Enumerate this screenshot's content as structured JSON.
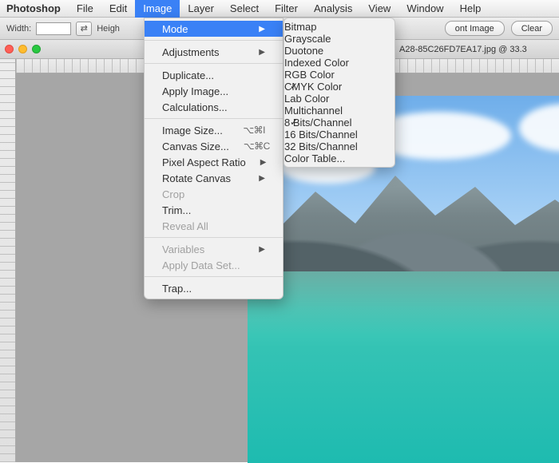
{
  "menubar": {
    "app": "Photoshop",
    "items": [
      "File",
      "Edit",
      "Image",
      "Layer",
      "Select",
      "Filter",
      "Analysis",
      "View",
      "Window",
      "Help"
    ],
    "active": "Image"
  },
  "optionsbar": {
    "width_label": "Width:",
    "width_value": "",
    "height_label": "Heigh",
    "front_image_label": "ont Image",
    "clear_label": "Clear"
  },
  "document": {
    "filename_fragment": "A28-85C26FD7EA17.jpg @ 33.3"
  },
  "image_menu": [
    {
      "label": "Mode",
      "submenu": true,
      "selected": true
    },
    {
      "sep": true
    },
    {
      "label": "Adjustments",
      "submenu": true
    },
    {
      "sep": true
    },
    {
      "label": "Duplicate..."
    },
    {
      "label": "Apply Image..."
    },
    {
      "label": "Calculations..."
    },
    {
      "sep": true
    },
    {
      "label": "Image Size...",
      "shortcut": "⌥⌘I"
    },
    {
      "label": "Canvas Size...",
      "shortcut": "⌥⌘C"
    },
    {
      "label": "Pixel Aspect Ratio",
      "submenu": true
    },
    {
      "label": "Rotate Canvas",
      "submenu": true
    },
    {
      "label": "Crop",
      "disabled": true
    },
    {
      "label": "Trim..."
    },
    {
      "label": "Reveal All",
      "disabled": true
    },
    {
      "sep": true
    },
    {
      "label": "Variables",
      "submenu": true,
      "disabled": true
    },
    {
      "label": "Apply Data Set...",
      "disabled": true
    },
    {
      "sep": true
    },
    {
      "label": "Trap..."
    }
  ],
  "mode_submenu": [
    {
      "label": "Bitmap",
      "disabled": true
    },
    {
      "label": "Grayscale"
    },
    {
      "label": "Duotone",
      "disabled": true
    },
    {
      "label": "Indexed Color",
      "disabled": true
    },
    {
      "label": "RGB Color"
    },
    {
      "label": "CMYK Color",
      "checked": true,
      "selected": true
    },
    {
      "label": "Lab Color"
    },
    {
      "label": "Multichannel"
    },
    {
      "sep": true
    },
    {
      "label": "8 Bits/Channel",
      "checked": true
    },
    {
      "label": "16 Bits/Channel"
    },
    {
      "label": "32 Bits/Channel",
      "disabled": true
    },
    {
      "sep": true
    },
    {
      "label": "Color Table...",
      "disabled": true
    }
  ]
}
